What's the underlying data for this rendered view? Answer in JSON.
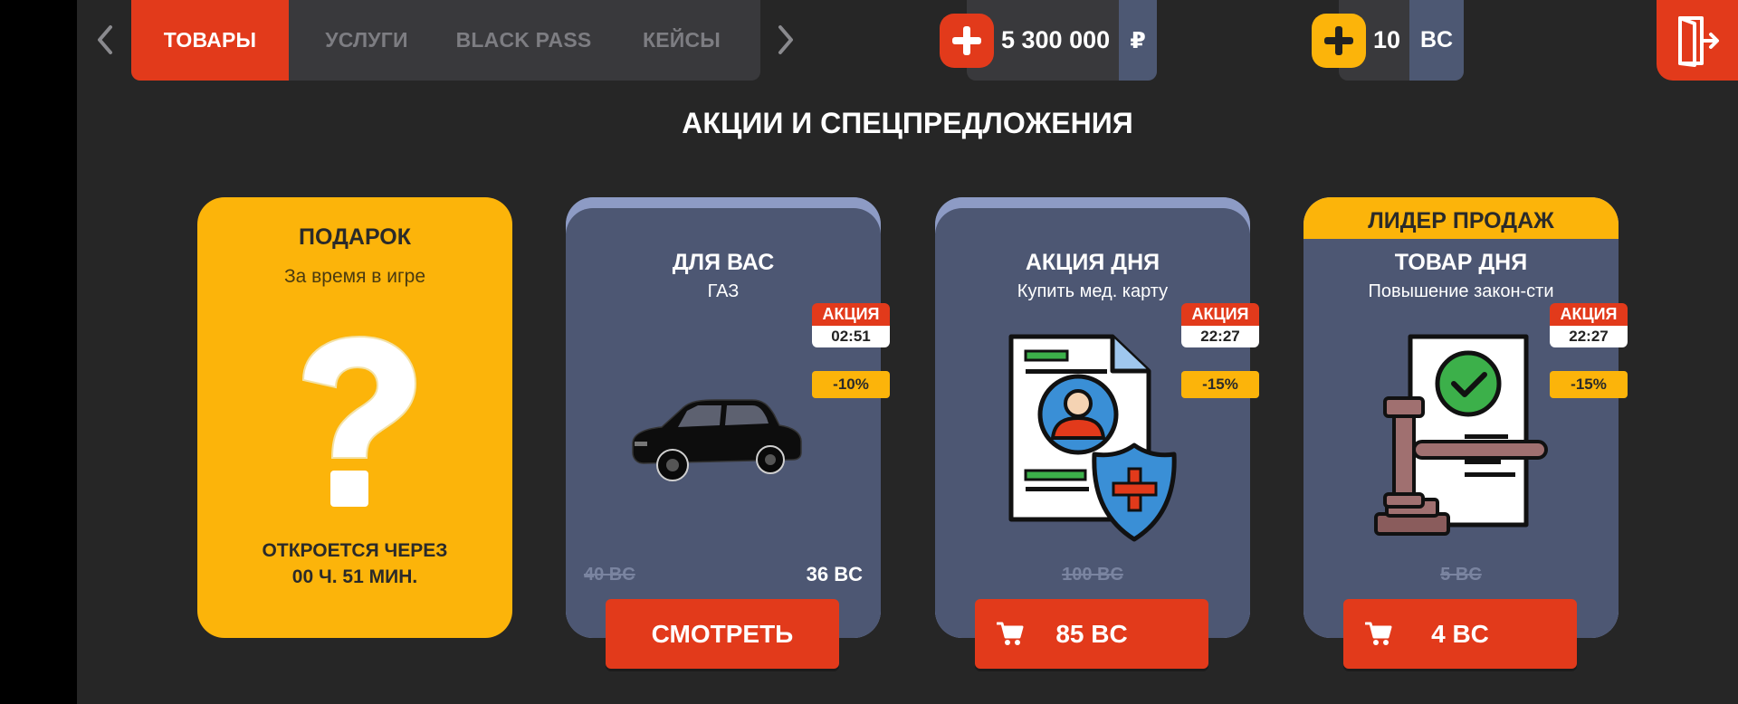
{
  "tabs": [
    {
      "label": "ТОВАРЫ",
      "active": true
    },
    {
      "label": "УСЛУГИ",
      "active": false
    },
    {
      "label": "BLACK PASS",
      "active": false
    },
    {
      "label": "КЕЙСЫ",
      "active": false
    }
  ],
  "balance": {
    "rub_value": "5 300 000",
    "rub_unit": "₽",
    "bc_value": "10",
    "bc_unit": "BC"
  },
  "colors": {
    "accent_red": "#e23a1b",
    "accent_yellow": "#fcb40a",
    "card_blue": "#4d5773",
    "background": "#262626"
  },
  "section_title": "АКЦИИ И СПЕЦПРЕДЛОЖЕНИЯ",
  "gift_card": {
    "title": "ПОДАРОК",
    "subtitle": "За время в игре",
    "icon": "question-mark-icon",
    "open_line1": "ОТКРОЕТСЯ ЧЕРЕЗ",
    "open_line2": "00 Ч. 51 МИН."
  },
  "offers": [
    {
      "title": "ДЛЯ ВАС",
      "subtitle": "ГАЗ",
      "promo_label": "АКЦИЯ",
      "promo_timer": "02:51",
      "discount": "-10%",
      "old_price": "40 BC",
      "new_price": "36 BC",
      "button_label": "СМОТРЕТЬ",
      "image": "black-car"
    },
    {
      "title": "АКЦИЯ ДНЯ",
      "subtitle": "Купить мед. карту",
      "promo_label": "АКЦИЯ",
      "promo_timer": "22:27",
      "discount": "-15%",
      "old_price": "100 BC",
      "button_label": "85 BC",
      "image": "medical-card-icon"
    },
    {
      "ribbon": "ЛИДЕР ПРОДАЖ",
      "title": "ТОВАР ДНЯ",
      "subtitle": "Повышение закон-сти",
      "promo_label": "АКЦИЯ",
      "promo_timer": "22:27",
      "discount": "-15%",
      "old_price": "5 BC",
      "button_label": "4 BC",
      "image": "gavel-document-icon"
    }
  ]
}
